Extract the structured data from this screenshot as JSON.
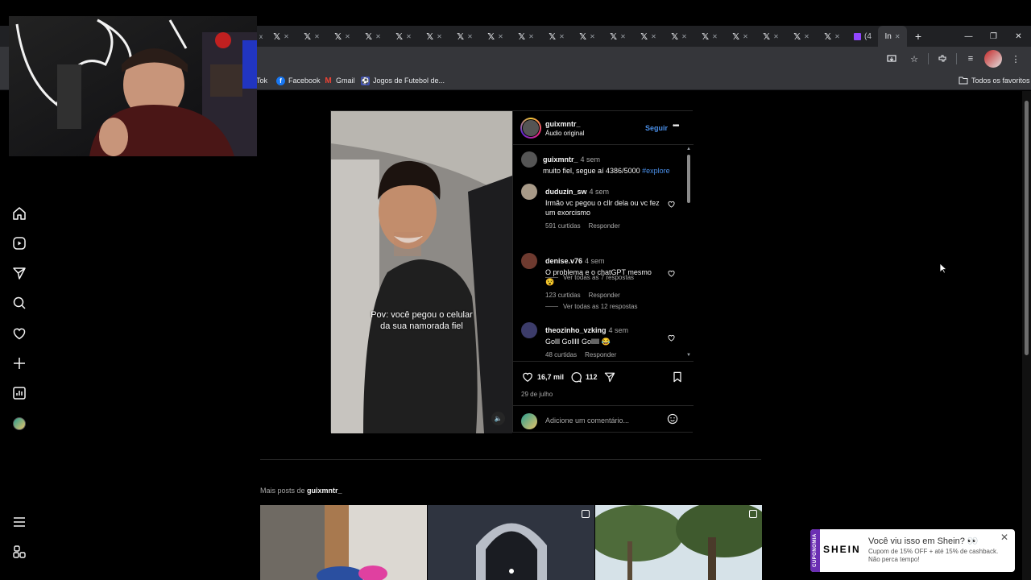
{
  "browser": {
    "tabs": [
      {
        "logo": "𝕏",
        "close": "✕"
      },
      {
        "logo": "𝕏",
        "close": "✕"
      },
      {
        "logo": "𝕏",
        "close": "✕"
      },
      {
        "logo": "𝕏",
        "close": "✕"
      },
      {
        "logo": "𝕏",
        "close": "✕"
      },
      {
        "logo": "𝕏",
        "close": "✕"
      },
      {
        "logo": "𝕏",
        "close": "✕"
      },
      {
        "logo": "𝕏",
        "close": "✕"
      },
      {
        "logo": "𝕏",
        "close": "✕"
      },
      {
        "logo": "𝕏",
        "close": "✕"
      },
      {
        "logo": "𝕏",
        "close": "✕"
      },
      {
        "logo": "𝕏",
        "close": "✕"
      },
      {
        "logo": "𝕏",
        "close": "✕"
      },
      {
        "logo": "𝕏",
        "close": "✕"
      },
      {
        "logo": "𝕏",
        "close": "✕"
      },
      {
        "logo": "𝕏",
        "close": "✕"
      },
      {
        "logo": "𝕏",
        "close": "✕"
      },
      {
        "logo": "𝕏",
        "close": "✕"
      },
      {
        "logo": "𝕏",
        "close": "✕"
      }
    ],
    "twitch_tab": "(4",
    "active_tab": "In",
    "bookmarks": {
      "tiktok": "Tok",
      "facebook": "Facebook",
      "gmail": "Gmail",
      "jogos": "Jogos de Futebol de...",
      "all_favorites": "Todos os favoritos"
    }
  },
  "post": {
    "username": "guixmntr_",
    "audio": "Áudio original",
    "follow": "Seguir",
    "more": "•••",
    "video_caption_line1": "Pov: você pegou o celular",
    "video_caption_line2": "da sua namorada fiel",
    "caption": {
      "user": "guixmntr_",
      "time": "4 sem",
      "text": "muito fiel, segue aí 4386/5000",
      "tag": "#explore"
    },
    "comments": [
      {
        "user": "duduzin_sw",
        "time": "4 sem",
        "text_line1": "Irmão vc pegou o cllr dela ou vc fez",
        "text_line2": "um exorcismo",
        "likes": "591 curtidas",
        "reply": "Responder",
        "view_replies": "Ver todas as 7 respostas"
      },
      {
        "user": "denise.v76",
        "time": "4 sem",
        "text_line1": "O problema e o chatGPT mesmo",
        "text_line2": "😵",
        "likes": "123 curtidas",
        "reply": "Responder",
        "view_replies": "Ver todas as 12 respostas"
      },
      {
        "user": "theozinho_vzking",
        "time": "4 sem",
        "text_line1": "Golll Golllll Golllll 😂",
        "likes": "48 curtidas",
        "reply": "Responder"
      }
    ],
    "like_count": "16,7 mil",
    "comment_count": "112",
    "date": "29 de julho",
    "add_comment_placeholder": "Adicione um comentário..."
  },
  "more_posts": {
    "prefix": "Mais posts de ",
    "user": "guixmntr_"
  },
  "shein_popup": {
    "band": "CUPONOMIA",
    "logo": "SHEIN",
    "title": "Você viu isso em Shein? 👀",
    "desc": "Cupom de 15% OFF + até 15% de cashback. Não perca tempo!",
    "close": "✕"
  },
  "colors": {
    "accent_blue": "#4a8fe8",
    "background": "#000000",
    "chrome_dark": "#202124",
    "chrome_toolbar": "#35363a",
    "shein_purple": "#6b2fb3"
  }
}
